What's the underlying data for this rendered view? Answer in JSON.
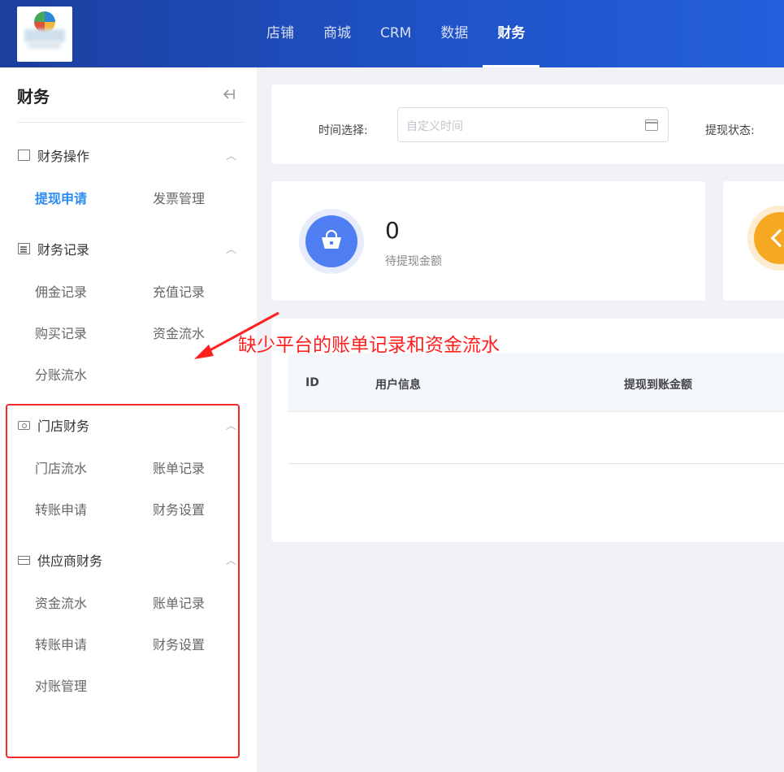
{
  "header": {
    "nav": [
      {
        "label": "店铺",
        "active": false
      },
      {
        "label": "商城",
        "active": false
      },
      {
        "label": "CRM",
        "active": false
      },
      {
        "label": "数据",
        "active": false
      },
      {
        "label": "财务",
        "active": true
      }
    ]
  },
  "sidebar": {
    "title": "财务",
    "groups": [
      {
        "label": "财务操作",
        "icon": "document-icon",
        "items": [
          "提现申请",
          "发票管理"
        ],
        "active_item": "提现申请"
      },
      {
        "label": "财务记录",
        "icon": "list-icon",
        "items": [
          "佣金记录",
          "充值记录",
          "购买记录",
          "资金流水",
          "分账流水"
        ]
      },
      {
        "label": "门店财务",
        "icon": "cash-icon",
        "items": [
          "门店流水",
          "账单记录",
          "转账申请",
          "财务设置"
        ]
      },
      {
        "label": "供应商财务",
        "icon": "card-icon",
        "items": [
          "资金流水",
          "账单记录",
          "转账申请",
          "财务设置",
          "对账管理"
        ]
      }
    ]
  },
  "filter": {
    "time_label": "时间选择:",
    "time_placeholder": "自定义时间",
    "status_label": "提现状态:"
  },
  "stats": [
    {
      "value": "0",
      "label": "待提现金额",
      "icon": "basket-icon",
      "color": "#4e7ef1"
    }
  ],
  "table": {
    "columns": [
      "ID",
      "用户信息",
      "提现到账金额"
    ]
  },
  "annotation": {
    "text": "缺少平台的账单记录和资金流水",
    "color": "#ff1f1f"
  }
}
